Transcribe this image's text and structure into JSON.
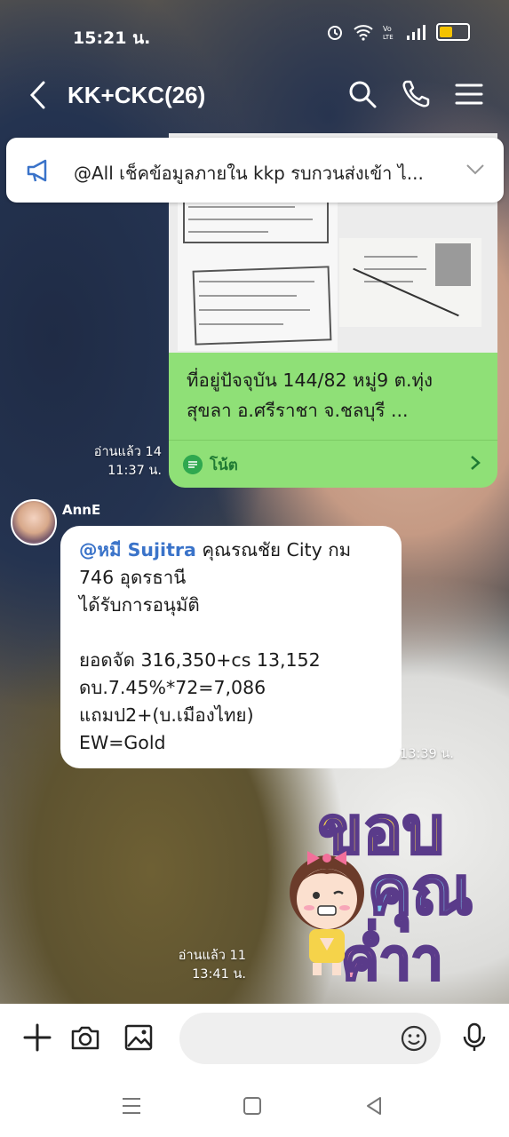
{
  "status_bar": {
    "time": "15:21 น.",
    "battery_color": "#f4c200"
  },
  "header": {
    "title": "KK+CKC(26)"
  },
  "announcement": {
    "text": "@All  เช็คข้อมูลภายใน kkp รบกวนส่งเข้า ไ..."
  },
  "note_message": {
    "line1": "ที่อยู่ปัจจุบัน 144/82 หมู่9 ต.ทุ่ง",
    "line2": "สุขลา อ.ศรีราชา จ.ชลบุรี ...",
    "label": "โน้ต",
    "read": "อ่านแล้ว 14",
    "time": "11:37 น."
  },
  "incoming_message": {
    "sender": "AnnE",
    "mention": "@หมี Sujitra",
    "line1_rest": " คุณรณชัย City กม",
    "line2": "746 อุดรธานี",
    "line3": "ได้รับการอนุมัติ",
    "line4": "ยอดจัด 316,350+cs 13,152",
    "line5": "ดบ.7.45%*72=7,086",
    "line6": "แถมป2+(บ.เมืองไทย)",
    "line7": "EW=Gold",
    "time": "13:39 น."
  },
  "sticker_message": {
    "line1": "ขอบ",
    "line2": "คุณ",
    "line3": "ค่ำา",
    "read": "อ่านแล้ว 11",
    "time": "13:41 น."
  },
  "colors": {
    "note_bubble": "#8fe077",
    "mention": "#3a73c9",
    "accent_green": "#2fa84f"
  }
}
